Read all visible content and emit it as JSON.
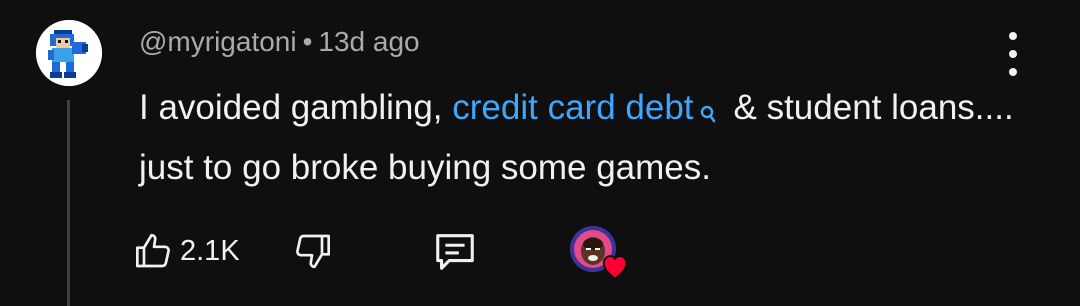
{
  "comment": {
    "author": "@myrigatoni",
    "separator": "•",
    "age": "13d ago",
    "text_before": "I avoided gambling, ",
    "link_text": "credit card debt",
    "text_after": "& student loans.... just to go broke buying some games.",
    "like_count": "2.1K"
  },
  "icons": {
    "avatar": "megaman-avatar",
    "more": "more-vert-icon",
    "search": "search-icon",
    "like": "thumb-up-icon",
    "dislike": "thumb-down-icon",
    "reply": "comment-icon",
    "creator_heart": "heart-icon"
  },
  "colors": {
    "background": "#0f0f0f",
    "text": "#f1f1f1",
    "meta": "#aaaaaa",
    "link": "#3ea6ff",
    "heart": "#ff0033"
  }
}
